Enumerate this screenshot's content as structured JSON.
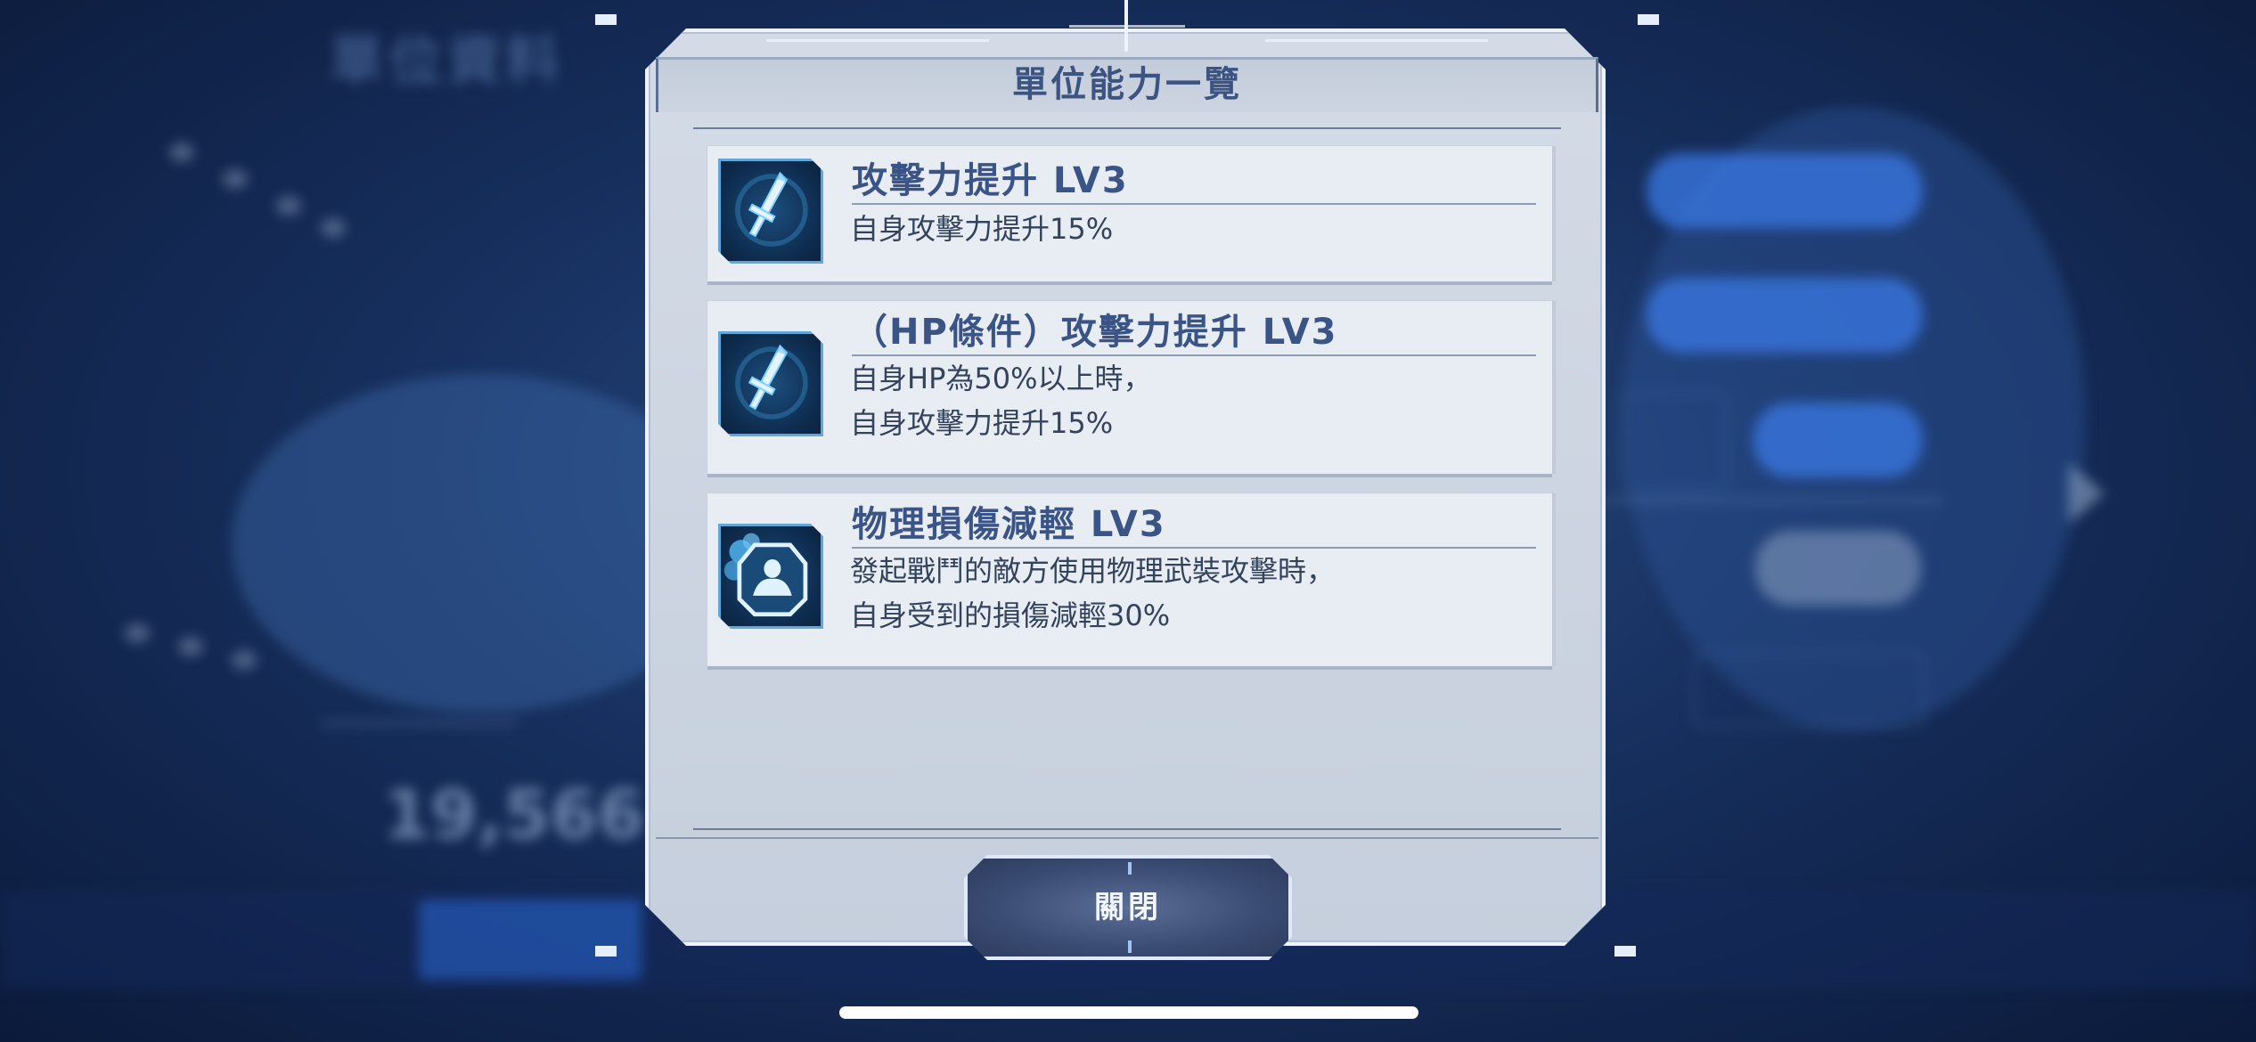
{
  "dialog": {
    "title": "單位能力一覽",
    "close_label": "關閉"
  },
  "skills": [
    {
      "icon": "sword-icon",
      "name": "攻擊力提升 LV3",
      "desc_lines": [
        "自身攻擊力提升15%"
      ]
    },
    {
      "icon": "sword-icon",
      "name": "（HP條件）攻擊力提升 LV3",
      "desc_lines": [
        "自身HP為50%以上時，",
        "自身攻擊力提升15%"
      ]
    },
    {
      "icon": "armor-shield-icon",
      "name": "物理損傷減輕 LV3",
      "desc_lines": [
        "發起戰鬥的敵方使用物理武裝攻擊時，",
        "自身受到的損傷減輕30%"
      ]
    }
  ],
  "background": {
    "title": "單位資料",
    "combat_power": "19,566"
  },
  "colors": {
    "accent": "#3a5486",
    "panel": "#e8ecf3",
    "icon_bg": "#0e2c4f",
    "icon_glow": "#5fa7d8"
  }
}
